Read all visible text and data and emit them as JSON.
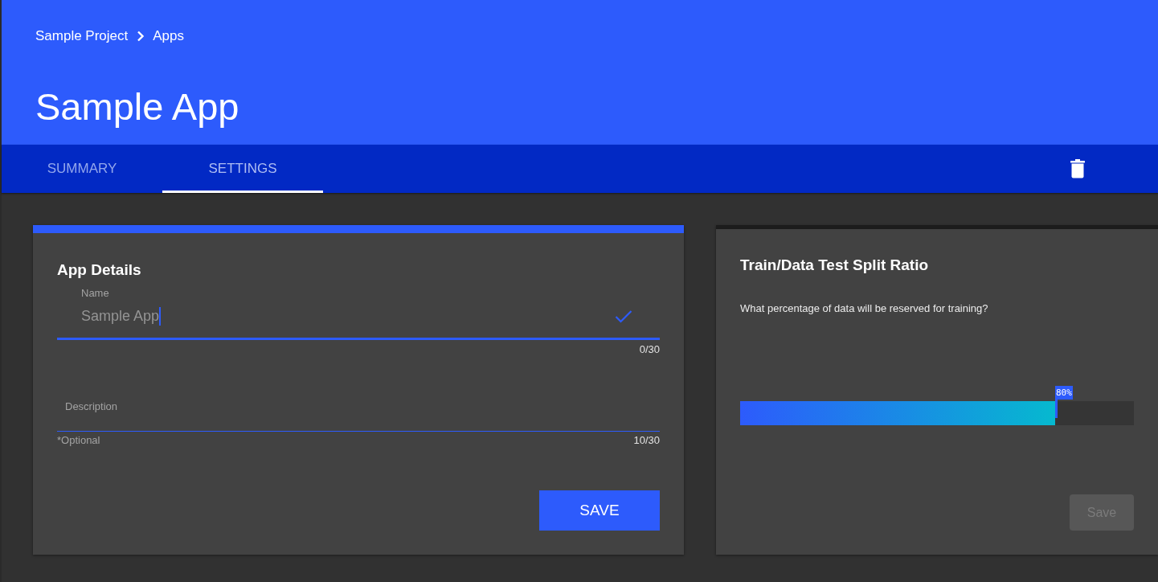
{
  "header": {
    "breadcrumb": [
      {
        "label": "Sample Project"
      },
      {
        "label": "Apps"
      }
    ],
    "title": "Sample App"
  },
  "tabs": [
    {
      "label": "SUMMARY",
      "selected": false
    },
    {
      "label": "SETTINGS",
      "selected": true
    }
  ],
  "cards": [
    {
      "kind": "app_details",
      "highlighted": true,
      "title": "App Details",
      "fields": [
        {
          "kind": "single_line",
          "label": "Name",
          "value": "Sample App",
          "focused": true,
          "valid": true,
          "counter": "0/30"
        },
        {
          "kind": "multi_line",
          "label": "Description",
          "focused": false,
          "valid": false,
          "hint": "*Optional",
          "counter": "10/30"
        }
      ],
      "button": {
        "label": "SAVE",
        "disabled": false
      }
    },
    {
      "kind": "split_ratio",
      "highlighted": false,
      "title": "Train/Data Test Split Ratio",
      "question": "What percentage of data will be reserved for training?",
      "slider": {
        "level": 0.8,
        "value_label": "80%"
      },
      "button": {
        "label": "Save",
        "disabled": true
      }
    }
  ]
}
